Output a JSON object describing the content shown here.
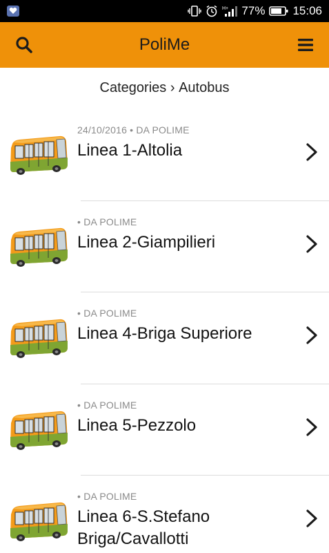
{
  "status_bar": {
    "battery_percent": "77%",
    "time": "15:06",
    "network_label": "H+",
    "icons": [
      "app-notification-icon",
      "vibrate-icon",
      "alarm-icon",
      "signal-icon",
      "battery-icon"
    ]
  },
  "app_bar": {
    "title": "PoliMe",
    "background": "#ef9109",
    "left_icon": "search-icon",
    "right_icon": "menu-icon"
  },
  "breadcrumb": {
    "root": "Categories",
    "separator": "›",
    "current": "Autobus"
  },
  "items": [
    {
      "meta": "24/10/2016 • DA POLIME",
      "title": "Linea 1-Altolia"
    },
    {
      "meta": "• DA POLIME",
      "title": "Linea 2-Giampilieri"
    },
    {
      "meta": "• DA POLIME",
      "title": "Linea 4-Briga Superiore"
    },
    {
      "meta": "• DA POLIME",
      "title": "Linea 5-Pezzolo"
    },
    {
      "meta": "• DA POLIME",
      "title": "Linea 6-S.Stefano Briga/Cavallotti"
    }
  ]
}
